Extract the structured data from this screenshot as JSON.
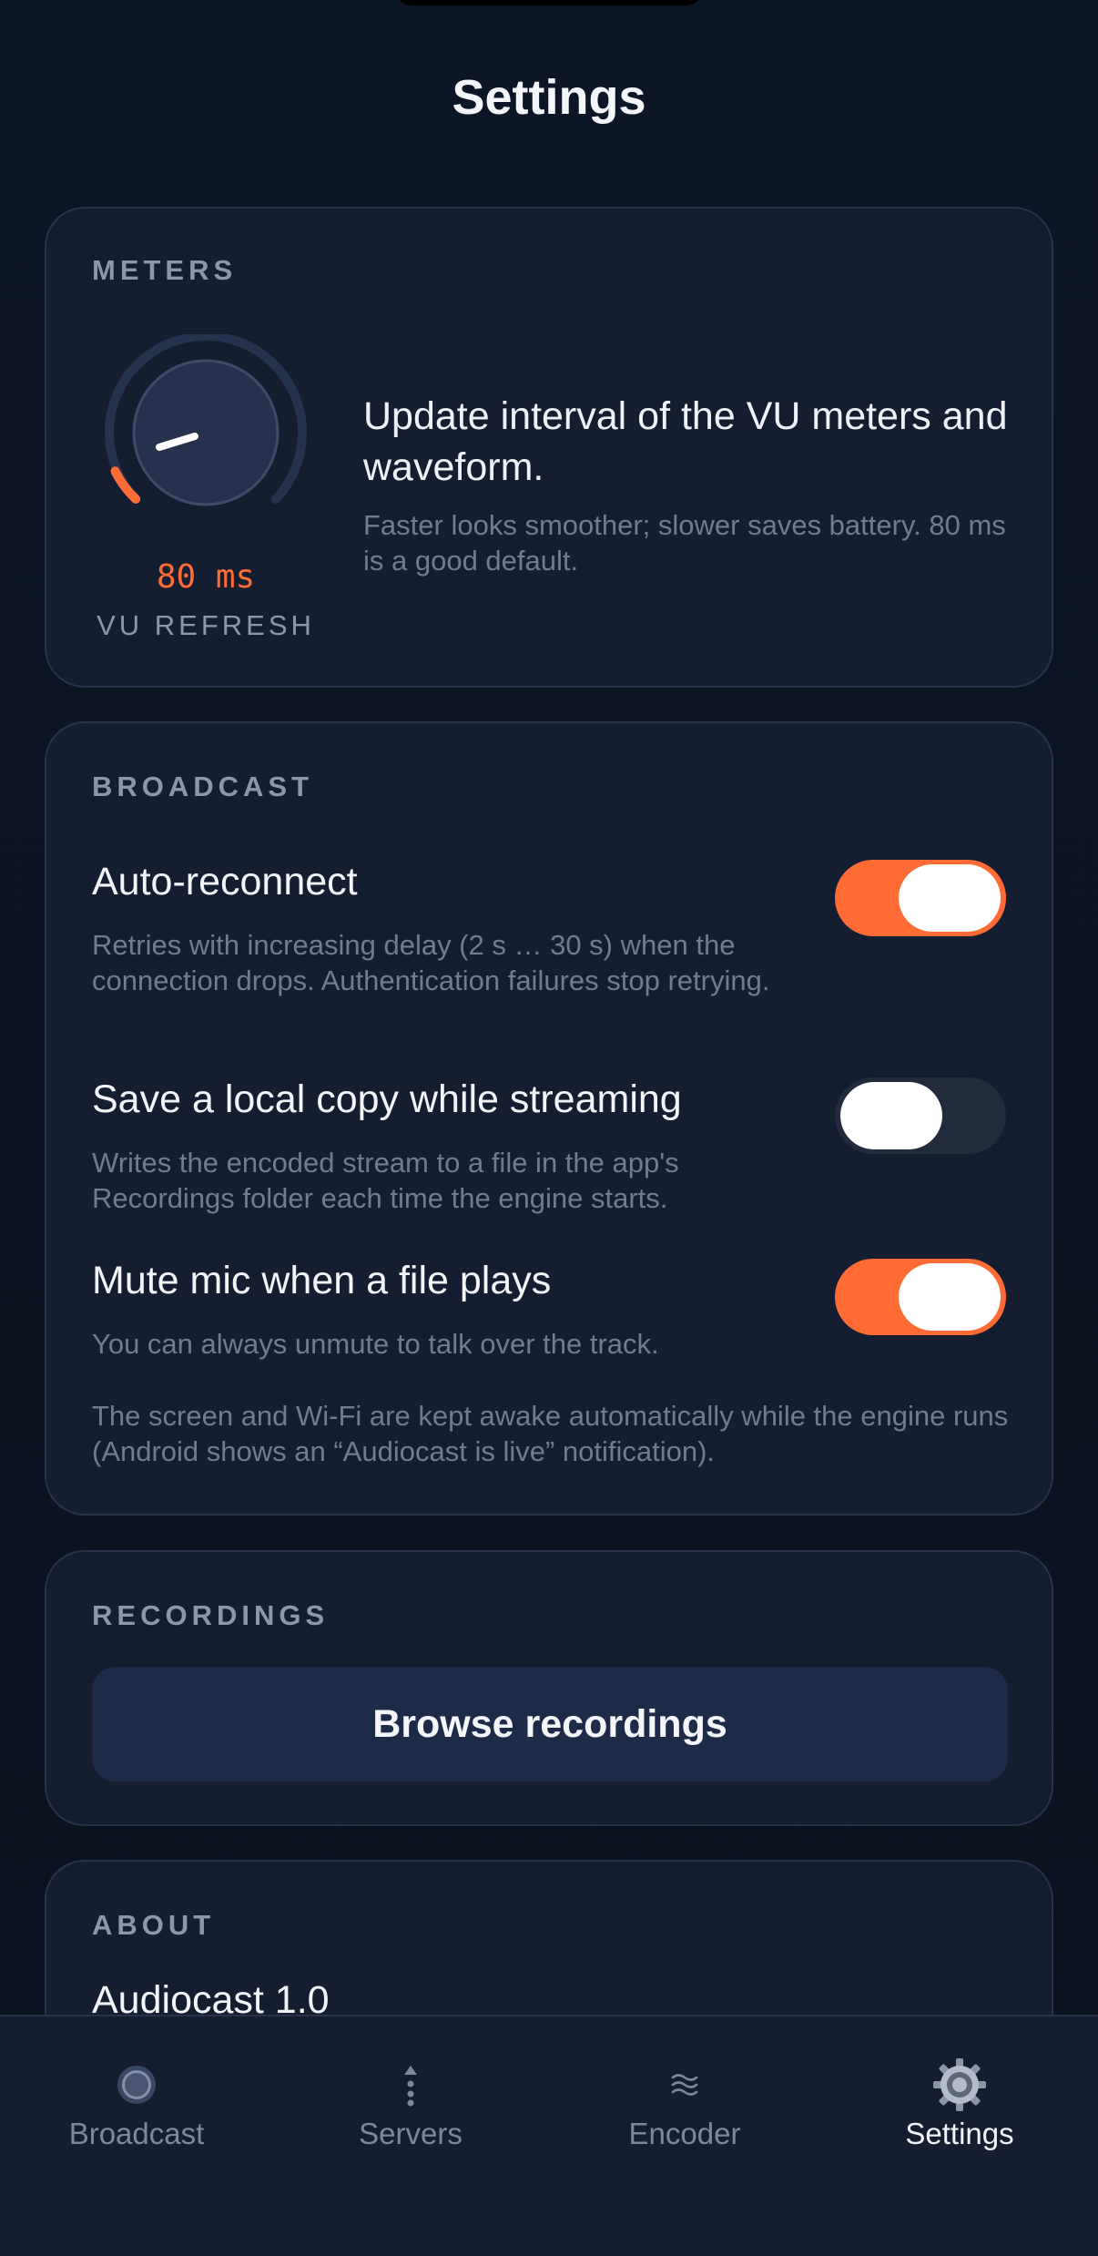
{
  "header": {
    "title": "Settings"
  },
  "meters": {
    "section_label": "METERS",
    "vu_value": "80 ms",
    "vu_caption": "VU REFRESH",
    "description": "Update interval of the VU meters and waveform.",
    "hint": "Faster looks smoother; slower saves battery. 80 ms is a good default."
  },
  "broadcast": {
    "section_label": "BROADCAST",
    "rows": [
      {
        "title": "Auto-reconnect",
        "desc": "Retries with increasing delay (2 s … 30 s) when the connection drops. Authentication failures stop retrying.",
        "enabled": true
      },
      {
        "title": "Save a local copy while streaming",
        "desc": "Writes the encoded stream to a file in the app's Recordings folder each time the engine starts.",
        "enabled": false
      },
      {
        "title": "Mute mic when a file plays",
        "desc": "You can always unmute to talk over the track.",
        "enabled": true
      }
    ],
    "note": "The screen and Wi-Fi are kept awake automatically while the engine runs (Android shows an “Audiocast is live” notification)."
  },
  "recordings": {
    "section_label": "RECORDINGS",
    "browse_label": "Browse recordings"
  },
  "about": {
    "section_label": "ABOUT",
    "app_name": "Audiocast 1.0"
  },
  "nav": {
    "items": [
      {
        "label": "Broadcast",
        "icon": "record-icon",
        "active": false
      },
      {
        "label": "Servers",
        "icon": "upload-icon",
        "active": false
      },
      {
        "label": "Encoder",
        "icon": "waves-icon",
        "active": false
      },
      {
        "label": "Settings",
        "icon": "gear-icon",
        "active": true
      }
    ]
  },
  "colors": {
    "accent": "#ff6b35",
    "background": "#0b1220",
    "card": "#151e31",
    "card_border": "#27334b",
    "muted_text": "#6f7c93",
    "button": "#1e2b48"
  }
}
